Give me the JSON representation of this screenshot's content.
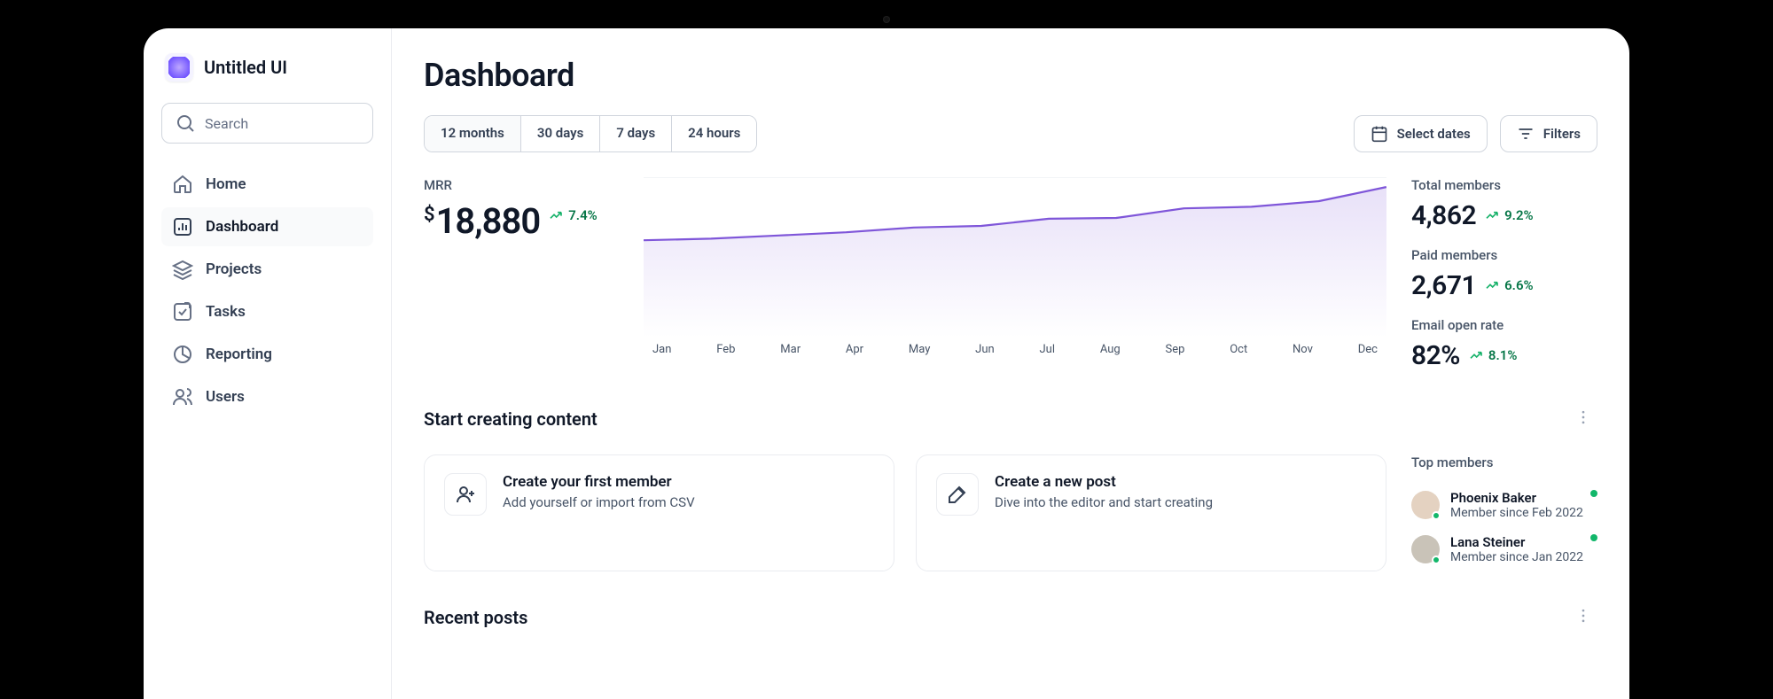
{
  "brand": {
    "name": "Untitled UI"
  },
  "search": {
    "placeholder": "Search"
  },
  "nav": [
    {
      "label": "Home",
      "icon": "home"
    },
    {
      "label": "Dashboard",
      "icon": "bar-chart",
      "active": true
    },
    {
      "label": "Projects",
      "icon": "layers"
    },
    {
      "label": "Tasks",
      "icon": "check-square"
    },
    {
      "label": "Reporting",
      "icon": "pie-chart"
    },
    {
      "label": "Users",
      "icon": "users"
    }
  ],
  "page": {
    "title": "Dashboard"
  },
  "range_tabs": [
    "12 months",
    "30 days",
    "7 days",
    "24 hours"
  ],
  "toolbar": {
    "select_dates": "Select dates",
    "filters": "Filters"
  },
  "mrr": {
    "label": "MRR",
    "currency": "$",
    "value": "18,880",
    "delta": "7.4%"
  },
  "stats": [
    {
      "label": "Total members",
      "value": "4,862",
      "delta": "9.2%"
    },
    {
      "label": "Paid members",
      "value": "2,671",
      "delta": "6.6%"
    },
    {
      "label": "Email open rate",
      "value": "82%",
      "delta": "8.1%"
    }
  ],
  "chart_data": {
    "type": "area",
    "title": "MRR",
    "xlabel": "",
    "ylabel": "",
    "categories": [
      "Jan",
      "Feb",
      "Mar",
      "Apr",
      "May",
      "Jun",
      "Jul",
      "Aug",
      "Sep",
      "Oct",
      "Nov",
      "Dec"
    ],
    "values": [
      12200,
      12400,
      12800,
      13200,
      13800,
      14000,
      14900,
      15000,
      16200,
      16400,
      17100,
      18880
    ],
    "ylim": [
      0,
      20000
    ],
    "color": "#7F56D9"
  },
  "sections": {
    "start_content": "Start creating content",
    "recent_posts": "Recent posts",
    "top_members": "Top members"
  },
  "cards": [
    {
      "title": "Create your first member",
      "sub": "Add yourself or import from CSV",
      "icon": "user-plus"
    },
    {
      "title": "Create a new post",
      "sub": "Dive into the editor and start creating",
      "icon": "pen"
    }
  ],
  "top_members": [
    {
      "name": "Phoenix Baker",
      "since": "Member since Feb 2022"
    },
    {
      "name": "Lana Steiner",
      "since": "Member since Jan 2022"
    }
  ]
}
